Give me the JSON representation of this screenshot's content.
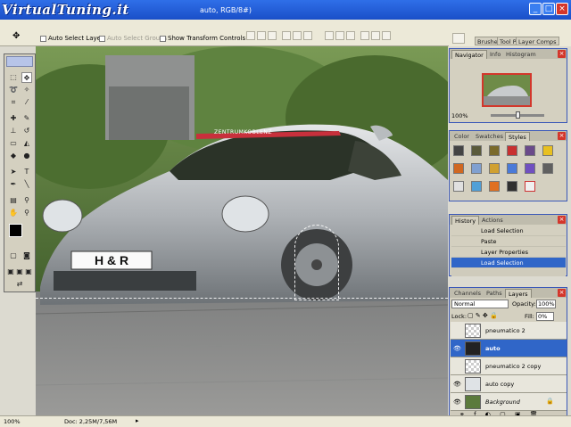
{
  "titlebar": {
    "watermark": "VirtualTuning.it",
    "doc_title": "auto, RGB/8#)",
    "buttons": [
      "_",
      "□",
      "×"
    ]
  },
  "options_bar": {
    "auto_select_layer": "Auto Select Layer",
    "auto_select_groups": "Auto Select Groups",
    "show_transform_controls": "Show Transform Controls"
  },
  "palette_well": {
    "tabs": [
      "Brushe",
      "Tool P",
      "Layer Comps"
    ]
  },
  "canvas": {
    "license_plate": "H & R",
    "windshield_banner": "ZENTRUMKOBLENZ"
  },
  "navigator": {
    "tabs": [
      "Navigator",
      "Info",
      "Histogram"
    ],
    "zoom": "100%"
  },
  "styles_panel": {
    "tabs": [
      "Color",
      "Swatches",
      "Styles"
    ]
  },
  "history_panel": {
    "tabs": [
      "History",
      "Actions"
    ],
    "items": [
      "Load Selection",
      "Paste",
      "Layer Properties",
      "Load Selection"
    ]
  },
  "layers_panel": {
    "tabs": [
      "Channels",
      "Paths",
      "Layers"
    ],
    "blend_mode": "Normal",
    "opacity_label": "Opacity:",
    "opacity_value": "100%",
    "lock_label": "Lock:",
    "fill_label": "Fill:",
    "fill_value": "0%",
    "layers": [
      "pneumatico 2",
      "auto",
      "pneumatico 2 copy",
      "auto copy",
      "Background"
    ]
  },
  "status_bar": {
    "zoom": "100%",
    "doc_info": "Doc: 2,25M/7,56M"
  },
  "colors": {
    "titlebar": "#1a4fc8",
    "selected_layer": "#3066c8",
    "close_red": "#d3362b"
  }
}
